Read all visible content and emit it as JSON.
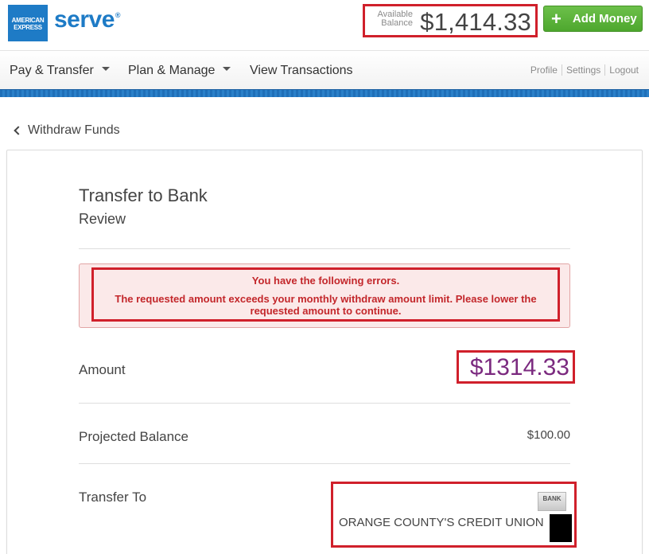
{
  "brand": {
    "amex_logo_text": "AMERICAN EXPRESS",
    "serve_text": "serve"
  },
  "header": {
    "balance_label": "Available Balance",
    "balance_value": "$1,414.33",
    "add_money_label": "Add Money"
  },
  "nav": {
    "items": [
      {
        "label": "Pay & Transfer",
        "has_dropdown": true
      },
      {
        "label": "Plan & Manage",
        "has_dropdown": true
      },
      {
        "label": "View Transactions",
        "has_dropdown": false
      }
    ],
    "utility_links": [
      "Profile",
      "Settings",
      "Logout"
    ]
  },
  "page": {
    "back_link": "Withdraw Funds",
    "title": "Transfer to Bank",
    "subtitle": "Review"
  },
  "errors": {
    "heading": "You have the following errors.",
    "message": "The requested amount exceeds your monthly withdraw amount limit. Please lower the requested amount to continue."
  },
  "review": {
    "amount_label": "Amount",
    "amount_value": "$1314.33",
    "projected_label": "Projected Balance",
    "projected_value": "$100.00",
    "transfer_label": "Transfer To",
    "bank_icon_text": "BANK",
    "bank_name": "ORANGE COUNTY'S CREDIT UNION"
  },
  "colors": {
    "brand_blue": "#1e7bc6",
    "highlight_red": "#d0202b",
    "add_money_green": "#5bb33a",
    "amount_purple": "#7b2a7f",
    "error_bg": "#fbe9e9",
    "error_text": "#c3272b"
  }
}
